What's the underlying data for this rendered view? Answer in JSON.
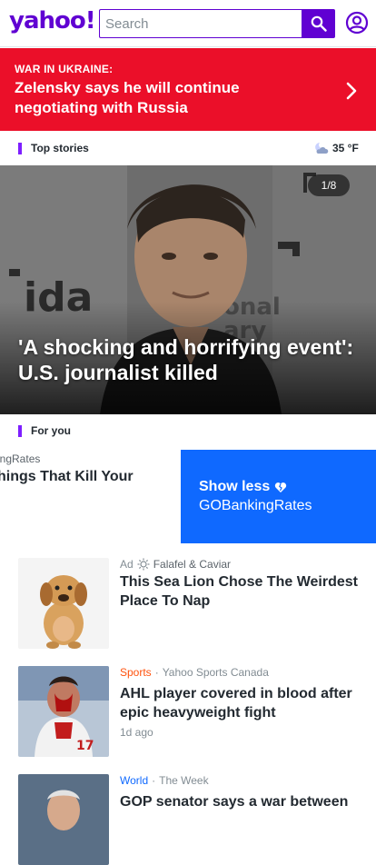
{
  "header": {
    "logo_text": "yahoo!",
    "search_placeholder": "Search",
    "brand_color": "#6001d2"
  },
  "breaking": {
    "kicker": "WAR IN UKRAINE:",
    "headline": "Zelensky says he will continue negotiating with Russia",
    "background": "#eb0f29"
  },
  "top_stories": {
    "label": "Top stories",
    "weather": {
      "icon": "moon-cloud-icon",
      "temp": "35 °F"
    }
  },
  "hero": {
    "counter": "1/8",
    "caption": "'A shocking and horrifying event': U.S. journalist killed"
  },
  "for_you": {
    "label": "For you",
    "partial_source": "ingRates",
    "partial_title": "hings That Kill Your",
    "show_less_label": "Show less",
    "show_less_source": "GOBankingRates"
  },
  "feed": [
    {
      "category": "Ad",
      "source": "Falafel & Caviar",
      "headline": "This Sea Lion Chose The Weirdest Place To Nap",
      "time": ""
    },
    {
      "category": "Sports",
      "category_color": "#ff520d",
      "source": "Yahoo Sports Canada",
      "headline": "AHL player covered in blood after epic heavyweight fight",
      "time": "1d ago"
    },
    {
      "category": "World",
      "category_color": "#0f69ff",
      "source": "The Week",
      "headline": "GOP senator says a war between",
      "time": ""
    }
  ]
}
